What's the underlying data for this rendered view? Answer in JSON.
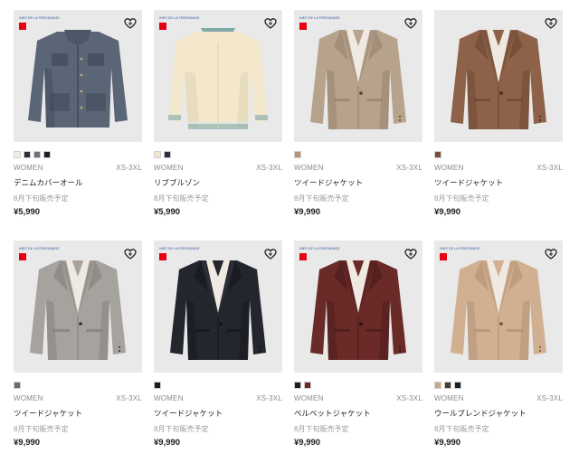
{
  "products": [
    {
      "badge": {
        "line1": "INES DE LA FRESSANGE",
        "line2": "UNIQLO"
      },
      "colors": [
        "#f2ede3",
        "#2c2f36",
        "#6f7178",
        "#1d1f26"
      ],
      "gender": "WOMEN",
      "sizes": "XS-3XL",
      "name": "デニムカバーオール",
      "note": "8月下旬販売予定",
      "price": "¥5,990",
      "garment": {
        "type": "jacket",
        "body": "#5a6576",
        "shade": "#3d4656",
        "collar": "#4c5767",
        "trim": "#c8a477"
      }
    },
    {
      "badge": {
        "line1": "INES DE LA FRESSANGE",
        "line2": "UNIQLO"
      },
      "colors": [
        "#efe4cc",
        "#2c2f3c"
      ],
      "gender": "WOMEN",
      "sizes": "XS-3XL",
      "name": "リブブルゾン",
      "note": "8月下旬販売予定",
      "price": "¥5,990",
      "garment": {
        "type": "blouson",
        "body": "#f3e8cc",
        "shade": "#ddd0b0",
        "collar": "#f3e8cc",
        "trim": "#7ea8a8"
      }
    },
    {
      "badge": {
        "line1": "INES DE LA FRESSANGE",
        "line2": "UNIQLO"
      },
      "colors": [
        "#b69478"
      ],
      "gender": "WOMEN",
      "sizes": "XS-3XL",
      "name": "ツイードジャケット",
      "note": "8月下旬販売予定",
      "price": "¥9,990",
      "garment": {
        "type": "blazer",
        "body": "#b7a38c",
        "shade": "#96826c",
        "collar": "#a89480",
        "trim": "#5a3a2c"
      }
    },
    {
      "badge": {
        "line1": "",
        "line2": ""
      },
      "colors": [
        "#7a4d3a"
      ],
      "gender": "WOMEN",
      "sizes": "XS-3XL",
      "name": "ツイードジャケット",
      "note": "8月下旬販売予定",
      "price": "¥9,990",
      "garment": {
        "type": "blazer",
        "body": "#8e6248",
        "shade": "#6b4634",
        "collar": "#7d553f",
        "trim": "#3b2a22"
      }
    },
    {
      "badge": {
        "line1": "INES DE LA FRESSANGE",
        "line2": "UNIQLO"
      },
      "colors": [
        "#6b6b6b"
      ],
      "gender": "WOMEN",
      "sizes": "XS-3XL",
      "name": "ツイードジャケット",
      "note": "8月下旬販売予定",
      "price": "¥9,990",
      "garment": {
        "type": "blazer",
        "body": "#a6a29d",
        "shade": "#827e79",
        "collar": "#96928d",
        "trim": "#2f2f2f"
      }
    },
    {
      "badge": {
        "line1": "INES DE LA FRESSANGE",
        "line2": "UNIQLO"
      },
      "colors": [
        "#1b1d24"
      ],
      "gender": "WOMEN",
      "sizes": "XS-3XL",
      "name": "ツイードジャケット",
      "note": "8月下旬販売予定",
      "price": "¥9,990",
      "garment": {
        "type": "blazer",
        "body": "#24262e",
        "shade": "#15161c",
        "collar": "#2c2e37",
        "trim": "#111"
      }
    },
    {
      "badge": {
        "line1": "INES DE LA FRESSANGE",
        "line2": "UNIQLO"
      },
      "colors": [
        "#1a1a1f",
        "#6e2a26"
      ],
      "gender": "WOMEN",
      "sizes": "XS-3XL",
      "name": "ベルベットジャケット",
      "note": "8月下旬販売予定",
      "price": "¥9,990",
      "garment": {
        "type": "blazer",
        "body": "#6a2a28",
        "shade": "#4a1b1a",
        "collar": "#5a2321",
        "trim": "#2a1010"
      }
    },
    {
      "badge": {
        "line1": "INES DE LA FRESSANGE",
        "line2": "UNIQLO"
      },
      "colors": [
        "#c9a88a",
        "#4a3a30",
        "#1c1d24"
      ],
      "gender": "WOMEN",
      "sizes": "XS-3XL",
      "name": "ウールブレンドジャケット",
      "note": "8月下旬販売予定",
      "price": "¥9,990",
      "garment": {
        "type": "blazer",
        "body": "#d1b092",
        "shade": "#b08f72",
        "collar": "#c3a283",
        "trim": "#6a4c36"
      }
    }
  ]
}
